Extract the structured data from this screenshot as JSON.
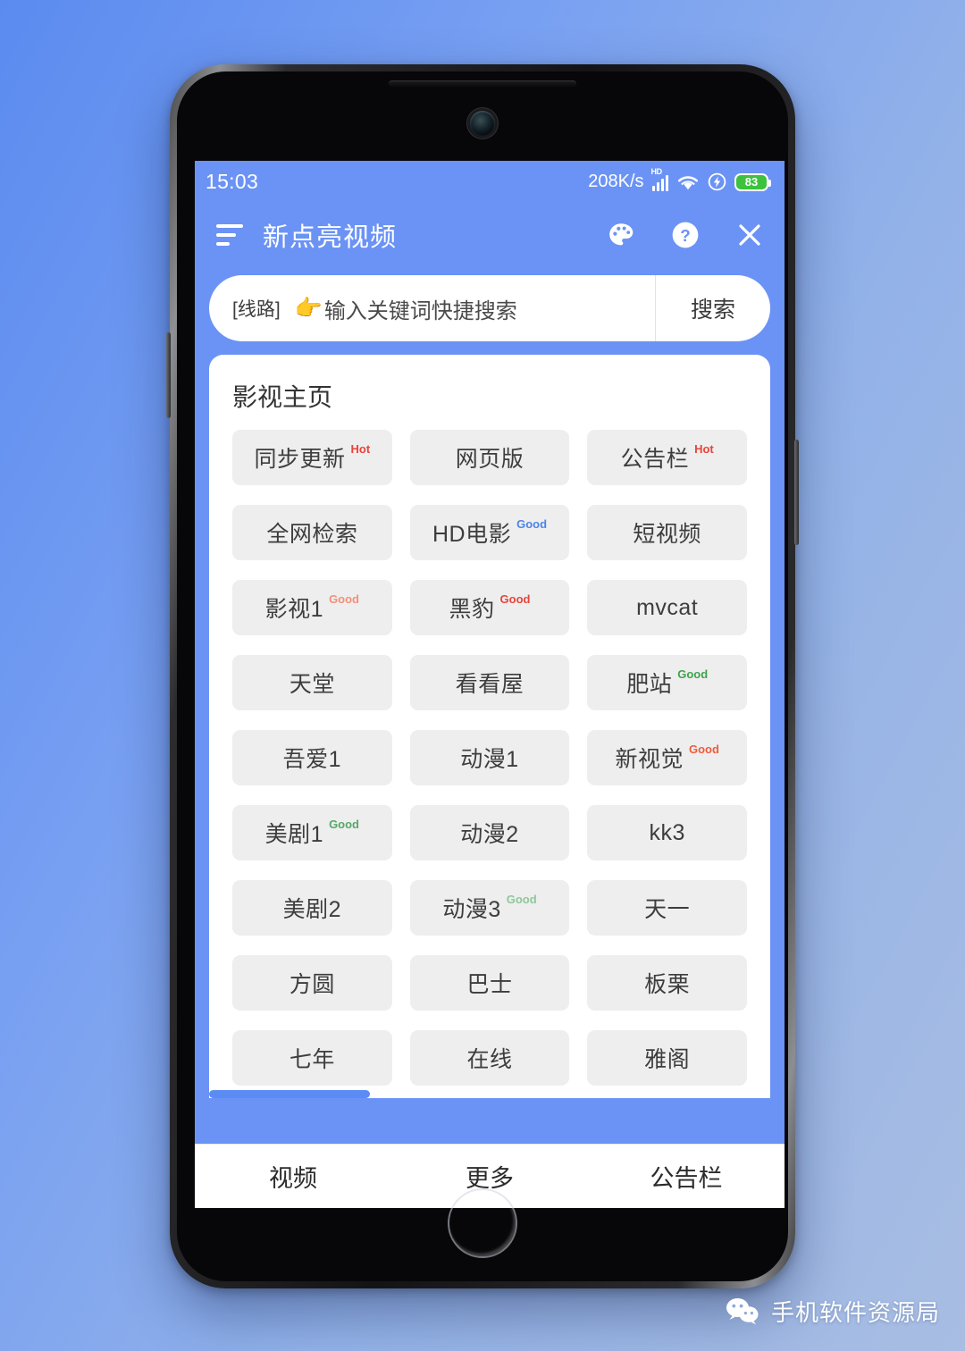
{
  "status_bar": {
    "clock": "15:03",
    "net_speed": "208K/s",
    "hd_tag": "HD",
    "battery_level": "83",
    "icons": [
      "signal-bars-icon",
      "wifi-icon",
      "flash-charging-icon",
      "battery-icon"
    ]
  },
  "header": {
    "menu_icon": "sort-lines-icon",
    "title": "新点亮视频",
    "actions": [
      {
        "name": "palette-icon",
        "label": "主题"
      },
      {
        "name": "help-icon",
        "label": "帮助"
      },
      {
        "name": "close-icon",
        "label": "关闭"
      }
    ]
  },
  "search": {
    "route_label": "[线路]",
    "hand_emoji": "👉",
    "placeholder": "输入关键词快捷搜索",
    "value": "",
    "button_label": "搜索"
  },
  "card": {
    "title": "影视主页",
    "tiles": [
      {
        "label": "同步更新",
        "badge": "Hot",
        "badge_color": "#e8443a"
      },
      {
        "label": "网页版",
        "badge": "",
        "badge_color": ""
      },
      {
        "label": "公告栏",
        "badge": "Hot",
        "badge_color": "#e8443a"
      },
      {
        "label": "全网检索",
        "badge": "",
        "badge_color": ""
      },
      {
        "label": "HD电影",
        "badge": "Good",
        "badge_color": "#4d84e8"
      },
      {
        "label": "短视频",
        "badge": "",
        "badge_color": ""
      },
      {
        "label": "影视1",
        "badge": "Good",
        "badge_color": "#f2907a"
      },
      {
        "label": "黑豹",
        "badge": "Good",
        "badge_color": "#e8443a"
      },
      {
        "label": "mvcat",
        "badge": "",
        "badge_color": ""
      },
      {
        "label": "天堂",
        "badge": "",
        "badge_color": ""
      },
      {
        "label": "看看屋",
        "badge": "",
        "badge_color": ""
      },
      {
        "label": "肥站",
        "badge": "Good",
        "badge_color": "#3fa34d"
      },
      {
        "label": "吾爱1",
        "badge": "",
        "badge_color": ""
      },
      {
        "label": "动漫1",
        "badge": "",
        "badge_color": ""
      },
      {
        "label": "新视觉",
        "badge": "Good",
        "badge_color": "#ef5b3e"
      },
      {
        "label": "美剧1",
        "badge": "Good",
        "badge_color": "#55a86a"
      },
      {
        "label": "动漫2",
        "badge": "",
        "badge_color": ""
      },
      {
        "label": "kk3",
        "badge": "",
        "badge_color": ""
      },
      {
        "label": "美剧2",
        "badge": "",
        "badge_color": ""
      },
      {
        "label": "动漫3",
        "badge": "Good",
        "badge_color": "#8fc79a"
      },
      {
        "label": "天一",
        "badge": "",
        "badge_color": ""
      },
      {
        "label": "方圆",
        "badge": "",
        "badge_color": ""
      },
      {
        "label": "巴士",
        "badge": "",
        "badge_color": ""
      },
      {
        "label": "板栗",
        "badge": "",
        "badge_color": ""
      },
      {
        "label": "七年",
        "badge": "",
        "badge_color": ""
      },
      {
        "label": "在线",
        "badge": "",
        "badge_color": ""
      },
      {
        "label": "雅阁",
        "badge": "",
        "badge_color": ""
      }
    ]
  },
  "bottom_nav": {
    "items": [
      {
        "label": "视频"
      },
      {
        "label": "更多"
      },
      {
        "label": "公告栏"
      }
    ]
  },
  "watermark": {
    "icon": "wechat-icon",
    "text": "手机软件资源局"
  },
  "theme": {
    "app_blue": "#6b93f5",
    "tile_bg": "#eeeeee",
    "battery_green": "#3ec13e",
    "scroll_blue": "#5b8bf5"
  }
}
